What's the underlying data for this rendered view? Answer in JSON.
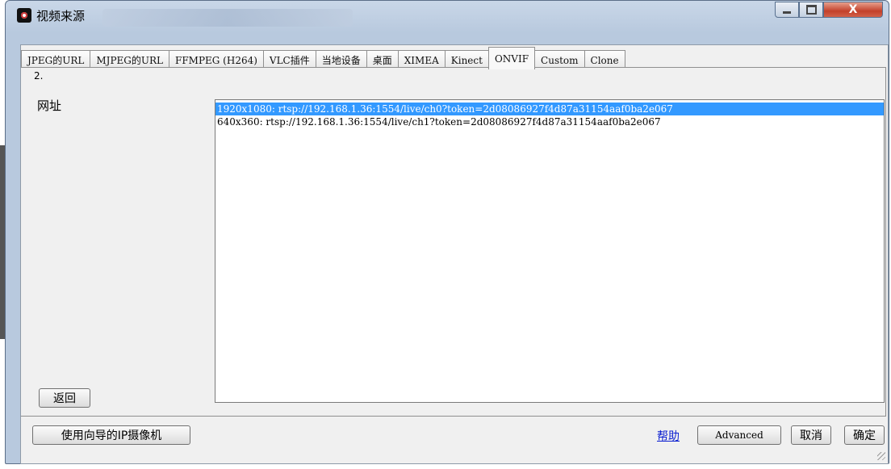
{
  "window": {
    "title": "视频来源"
  },
  "tabs": [
    {
      "label": "JPEG的URL"
    },
    {
      "label": "MJPEG的URL"
    },
    {
      "label": "FFMPEG (H264)"
    },
    {
      "label": "VLC插件"
    },
    {
      "label": "当地设备"
    },
    {
      "label": "桌面"
    },
    {
      "label": "XIMEA"
    },
    {
      "label": "Kinect"
    },
    {
      "label": "ONVIF",
      "active": true
    },
    {
      "label": "Custom"
    },
    {
      "label": "Clone"
    }
  ],
  "panel": {
    "step_label": "2.",
    "url_label": "网址",
    "stream_list": [
      {
        "text": "1920x1080: rtsp://192.168.1.36:1554/live/ch0?token=2d08086927f4d87a31154aaf0ba2e067",
        "selected": true
      },
      {
        "text": "640x360: rtsp://192.168.1.36:1554/live/ch1?token=2d08086927f4d87a31154aaf0ba2e067",
        "selected": false
      }
    ],
    "back_label": "返回"
  },
  "footer": {
    "wizard_label": "使用向导的IP摄像机",
    "help_label": "帮助",
    "advanced_label": "Advanced",
    "cancel_label": "取消",
    "ok_label": "确定"
  },
  "caption_buttons": {
    "close_glyph": "X"
  },
  "colors": {
    "selection": "#3399ff",
    "link": "#0b1fd1"
  }
}
